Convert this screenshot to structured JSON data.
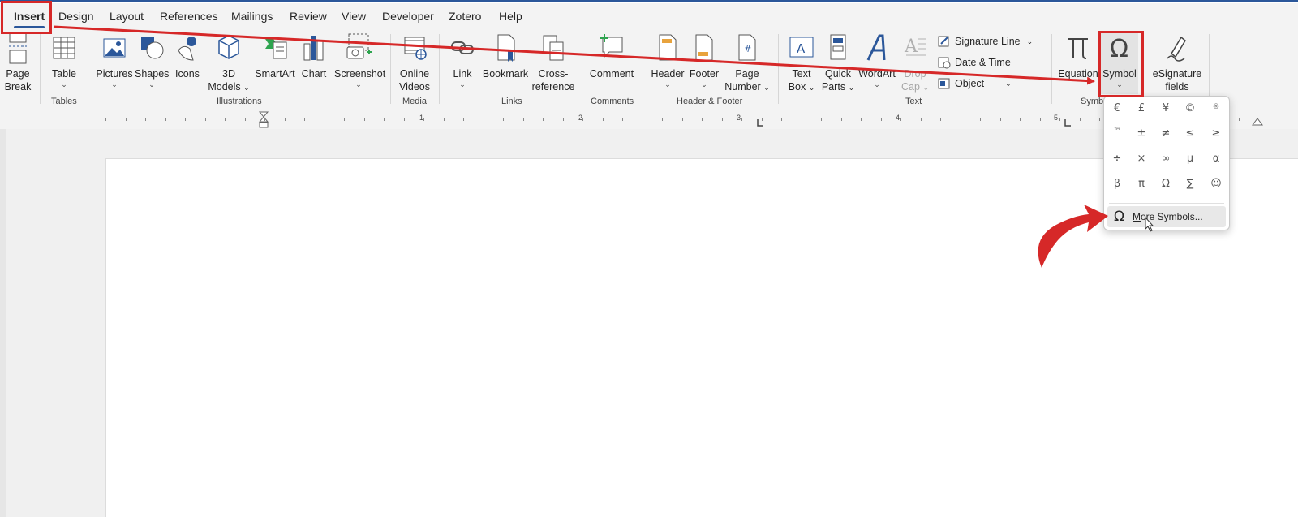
{
  "tabs": [
    {
      "label": "Insert",
      "active": true
    },
    {
      "label": "Design"
    },
    {
      "label": "Layout"
    },
    {
      "label": "References"
    },
    {
      "label": "Mailings"
    },
    {
      "label": "Review"
    },
    {
      "label": "View"
    },
    {
      "label": "Developer"
    },
    {
      "label": "Zotero"
    },
    {
      "label": "Help"
    }
  ],
  "ribbon": {
    "page_break": {
      "line1": "Page",
      "line2": "Break"
    },
    "table": "Table",
    "pictures": "Pictures",
    "shapes": "Shapes",
    "icons": "Icons",
    "models_3d": {
      "line1": "3D",
      "line2": "Models"
    },
    "smartart": "SmartArt",
    "chart": "Chart",
    "screenshot": "Screenshot",
    "online_videos": {
      "line1": "Online",
      "line2": "Videos"
    },
    "link": "Link",
    "bookmark": "Bookmark",
    "cross_reference": {
      "line1": "Cross-",
      "line2": "reference"
    },
    "comment": "Comment",
    "header": "Header",
    "footer": "Footer",
    "page_number": {
      "line1": "Page",
      "line2": "Number"
    },
    "text_box": {
      "line1": "Text",
      "line2": "Box"
    },
    "quick_parts": {
      "line1": "Quick",
      "line2": "Parts"
    },
    "wordart": "WordArt",
    "drop_cap": {
      "line1": "Drop",
      "line2": "Cap"
    },
    "signature_line": "Signature Line",
    "date_time": "Date & Time",
    "object": "Object",
    "equation": "Equation",
    "symbol": "Symbol",
    "esignature": {
      "line1": "eSignature",
      "line2": "fields"
    }
  },
  "groups": {
    "tables": "Tables",
    "illustrations": "Illustrations",
    "media": "Media",
    "links": "Links",
    "comments": "Comments",
    "header_footer": "Header & Footer",
    "text": "Text",
    "symbols": "Symb"
  },
  "ruler": [
    "1",
    "2",
    "3",
    "4",
    "5"
  ],
  "symbol_menu": {
    "symbols": [
      "€",
      "£",
      "¥",
      "©",
      "®",
      "™",
      "±",
      "≠",
      "≤",
      "≥",
      "÷",
      "×",
      "∞",
      "µ",
      "α",
      "β",
      "π",
      "Ω",
      "∑",
      "☺"
    ],
    "more_symbols_prefix": "M",
    "more_symbols_rest": "ore Symbols..."
  },
  "colors": {
    "accent": "#2b579a",
    "annotation_red": "#d62828"
  }
}
